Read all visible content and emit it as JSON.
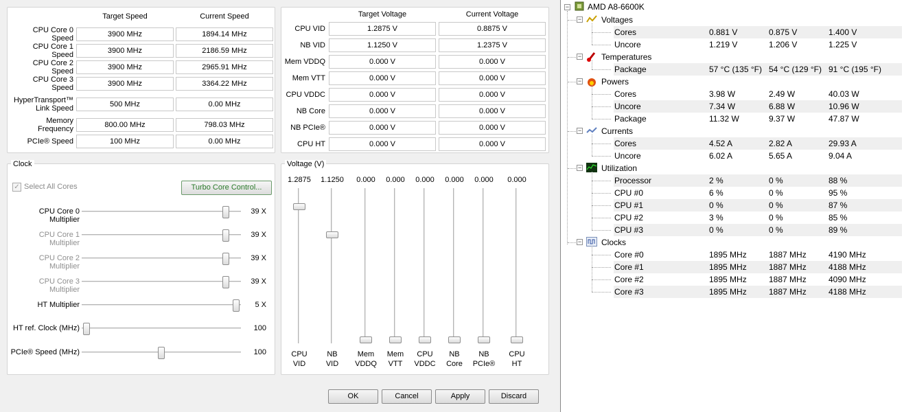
{
  "speed_panel": {
    "headers": [
      "Target Speed",
      "Current Speed"
    ],
    "rows": [
      {
        "label": "CPU Core 0 Speed",
        "target": "3900 MHz",
        "current": "1894.14 MHz"
      },
      {
        "label": "CPU Core 1 Speed",
        "target": "3900 MHz",
        "current": "2186.59 MHz"
      },
      {
        "label": "CPU Core 2 Speed",
        "target": "3900 MHz",
        "current": "2965.91 MHz"
      },
      {
        "label": "CPU Core 3 Speed",
        "target": "3900 MHz",
        "current": "3364.22 MHz"
      },
      {
        "label": "HyperTransport™ Link Speed",
        "target": "500 MHz",
        "current": "0.00 MHz"
      },
      {
        "label": "Memory Frequency",
        "target": "800.00 MHz",
        "current": "798.03 MHz"
      },
      {
        "label": "PCIe® Speed",
        "target": "100 MHz",
        "current": "0.00 MHz"
      }
    ]
  },
  "voltage_panel": {
    "headers": [
      "Target Voltage",
      "Current Voltage"
    ],
    "rows": [
      {
        "label": "CPU VID",
        "target": "1.2875 V",
        "current": "0.8875 V"
      },
      {
        "label": "NB VID",
        "target": "1.1250 V",
        "current": "1.2375 V"
      },
      {
        "label": "Mem VDDQ",
        "target": "0.000 V",
        "current": "0.000 V"
      },
      {
        "label": "Mem VTT",
        "target": "0.000 V",
        "current": "0.000 V"
      },
      {
        "label": "CPU VDDC",
        "target": "0.000 V",
        "current": "0.000 V"
      },
      {
        "label": "NB Core",
        "target": "0.000 V",
        "current": "0.000 V"
      },
      {
        "label": "NB PCIe®",
        "target": "0.000 V",
        "current": "0.000 V"
      },
      {
        "label": "CPU HT",
        "target": "0.000 V",
        "current": "0.000 V"
      }
    ]
  },
  "clock": {
    "title": "Clock",
    "select_all_label": "Select All Cores",
    "select_all_checked": true,
    "turbo_button": "Turbo Core Control...",
    "sliders": [
      {
        "label": "CPU Core 0 Multiplier",
        "value": "39 X",
        "level": 0.93,
        "enabled": true
      },
      {
        "label": "CPU Core 1 Multiplier",
        "value": "39 X",
        "level": 0.93,
        "enabled": false
      },
      {
        "label": "CPU Core 2 Multiplier",
        "value": "39 X",
        "level": 0.93,
        "enabled": false
      },
      {
        "label": "CPU Core 3 Multiplier",
        "value": "39 X",
        "level": 0.93,
        "enabled": false
      },
      {
        "label": "HT Multiplier",
        "value": "5 X",
        "level": 1.0,
        "enabled": true
      },
      {
        "label": "HT ref. Clock (MHz)",
        "value": "100",
        "level": 0.0,
        "enabled": true
      },
      {
        "label": "PCIe® Speed (MHz)",
        "value": "100",
        "level": 0.5,
        "enabled": true
      }
    ]
  },
  "voltage_sliders": {
    "title": "Voltage (V)",
    "items": [
      {
        "label1": "CPU",
        "label2": "VID",
        "value": "1.2875",
        "level": 0.9
      },
      {
        "label1": "NB",
        "label2": "VID",
        "value": "1.1250",
        "level": 0.71
      },
      {
        "label1": "Mem",
        "label2": "VDDQ",
        "value": "0.000",
        "level": 0.0
      },
      {
        "label1": "Mem",
        "label2": "VTT",
        "value": "0.000",
        "level": 0.0
      },
      {
        "label1": "CPU",
        "label2": "VDDC",
        "value": "0.000",
        "level": 0.0
      },
      {
        "label1": "NB",
        "label2": "Core",
        "value": "0.000",
        "level": 0.0
      },
      {
        "label1": "NB",
        "label2": "PCIe®",
        "value": "0.000",
        "level": 0.0
      },
      {
        "label1": "CPU",
        "label2": "HT",
        "value": "0.000",
        "level": 0.0
      }
    ]
  },
  "buttons": {
    "ok": "OK",
    "cancel": "Cancel",
    "apply": "Apply",
    "discard": "Discard"
  },
  "hwmonitor": {
    "root": "AMD A8-6600K",
    "groups": [
      {
        "name": "Voltages",
        "icon": "voltage-icon",
        "rows": [
          {
            "name": "Cores",
            "value": "0.881 V",
            "min": "0.875 V",
            "max": "1.400 V"
          },
          {
            "name": "Uncore",
            "value": "1.219 V",
            "min": "1.206 V",
            "max": "1.225 V"
          }
        ]
      },
      {
        "name": "Temperatures",
        "icon": "thermometer-icon",
        "rows": [
          {
            "name": "Package",
            "value": "57 °C  (135 °F)",
            "min": "54 °C  (129 °F)",
            "max": "91 °C  (195 °F)"
          }
        ]
      },
      {
        "name": "Powers",
        "icon": "flame-icon",
        "rows": [
          {
            "name": "Cores",
            "value": "3.98 W",
            "min": "2.49 W",
            "max": "40.03 W"
          },
          {
            "name": "Uncore",
            "value": "7.34 W",
            "min": "6.88 W",
            "max": "10.96 W"
          },
          {
            "name": "Package",
            "value": "11.32 W",
            "min": "9.37 W",
            "max": "47.87 W"
          }
        ]
      },
      {
        "name": "Currents",
        "icon": "current-icon",
        "rows": [
          {
            "name": "Cores",
            "value": "4.52 A",
            "min": "2.82 A",
            "max": "29.93 A"
          },
          {
            "name": "Uncore",
            "value": "6.02 A",
            "min": "5.65 A",
            "max": "9.04 A"
          }
        ]
      },
      {
        "name": "Utilization",
        "icon": "utilization-icon",
        "rows": [
          {
            "name": "Processor",
            "value": "2 %",
            "min": "0 %",
            "max": "88 %"
          },
          {
            "name": "CPU #0",
            "value": "6 %",
            "min": "0 %",
            "max": "95 %"
          },
          {
            "name": "CPU #1",
            "value": "0 %",
            "min": "0 %",
            "max": "87 %"
          },
          {
            "name": "CPU #2",
            "value": "3 %",
            "min": "0 %",
            "max": "85 %"
          },
          {
            "name": "CPU #3",
            "value": "0 %",
            "min": "0 %",
            "max": "89 %"
          }
        ]
      },
      {
        "name": "Clocks",
        "icon": "clock-wave-icon",
        "rows": [
          {
            "name": "Core #0",
            "value": "1895 MHz",
            "min": "1887 MHz",
            "max": "4190 MHz"
          },
          {
            "name": "Core #1",
            "value": "1895 MHz",
            "min": "1887 MHz",
            "max": "4188 MHz"
          },
          {
            "name": "Core #2",
            "value": "1895 MHz",
            "min": "1887 MHz",
            "max": "4090 MHz"
          },
          {
            "name": "Core #3",
            "value": "1895 MHz",
            "min": "1887 MHz",
            "max": "4188 MHz"
          }
        ]
      }
    ]
  }
}
